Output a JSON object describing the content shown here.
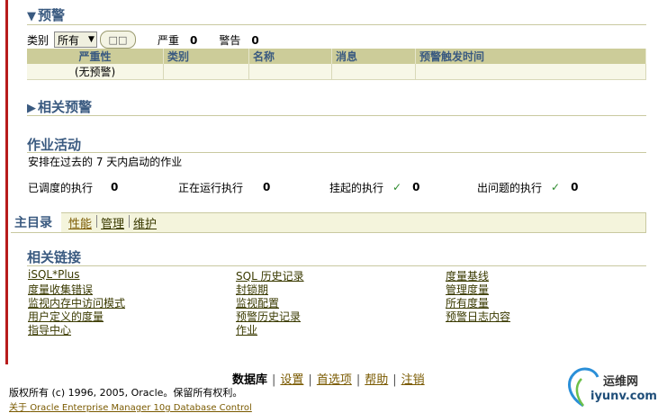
{
  "alerts": {
    "title": "预警",
    "filter_label": "类别",
    "filter_value": "所有",
    "go_label": "□□",
    "critical_label": "严重",
    "critical_count": "0",
    "warning_label": "警告",
    "warning_count": "0",
    "columns": [
      "严重性",
      "类别",
      "名称",
      "消息",
      "预警触发时间"
    ],
    "empty_row": "(无预警)"
  },
  "related_alerts": {
    "title": "相关预警"
  },
  "jobs": {
    "title": "作业活动",
    "description": "安排在过去的  7 天内启动的作业",
    "items": [
      {
        "label": "已调度的执行",
        "value": "0"
      },
      {
        "label": "正在运行执行",
        "value": "0"
      },
      {
        "label": "挂起的执行",
        "value": "0",
        "check": "✓"
      },
      {
        "label": "出问题的执行",
        "value": "0",
        "check": "✓"
      }
    ]
  },
  "tabs": {
    "active": "主目录",
    "items": [
      "性能",
      "管理",
      "维护"
    ]
  },
  "related_links": {
    "title": "相关链接",
    "col1": [
      "iSQL*Plus",
      "度量收集错误",
      "监视内存中访问模式",
      "用户定义的度量",
      "指导中心"
    ],
    "col2": [
      "SQL 历史记录",
      "封锁期",
      "监视配置",
      "预警历史记录",
      "作业"
    ],
    "col3": [
      "度量基线",
      "管理度量",
      "所有度量",
      "预警日志内容"
    ]
  },
  "footer": {
    "current": "数据库",
    "links": [
      "设置",
      "首选项",
      "帮助",
      "注销"
    ],
    "copyright": "版权所有 (c) 1996, 2005, Oracle。保留所有权利。",
    "about_word": "关于",
    "about_link": "Oracle Enterprise Manager 10g Database Control"
  },
  "watermark": {
    "cn": "运维网",
    "en": "iyunv.com"
  }
}
